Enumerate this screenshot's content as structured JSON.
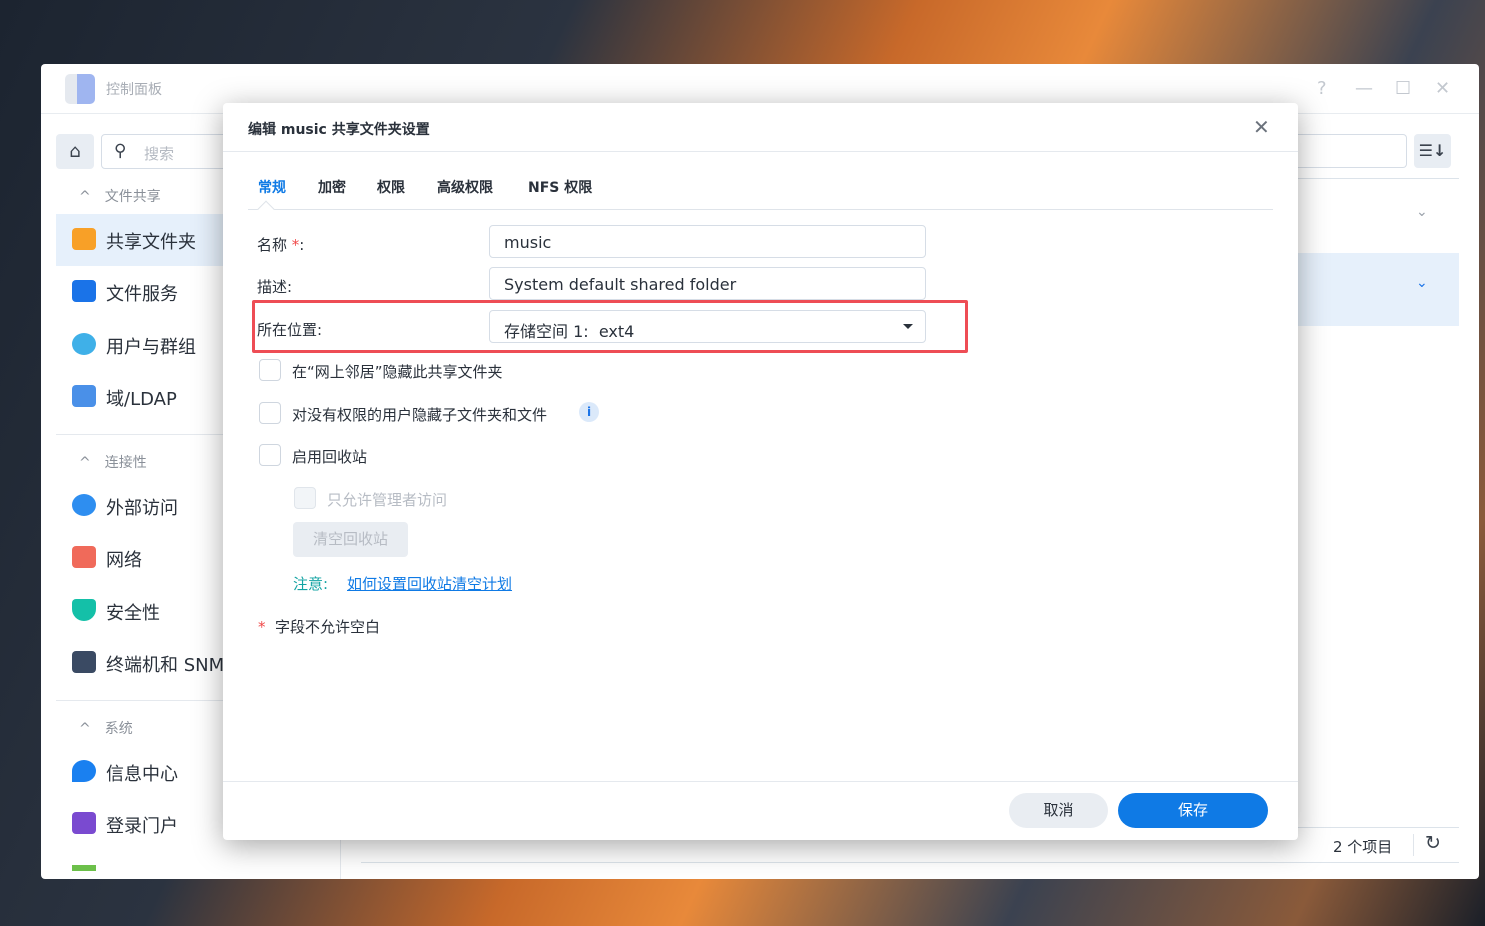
{
  "window": {
    "title": "控制面板",
    "controls": [
      "?",
      "—",
      "☐",
      "✕"
    ]
  },
  "sidebar": {
    "search_placeholder": "搜索",
    "sections": [
      {
        "title": "文件共享",
        "items": [
          {
            "label": "共享文件夹",
            "selected": true
          },
          {
            "label": "文件服务"
          },
          {
            "label": "用户与群组"
          },
          {
            "label": "域/LDAP"
          }
        ]
      },
      {
        "title": "连接性",
        "items": [
          {
            "label": "外部访问"
          },
          {
            "label": "网络"
          },
          {
            "label": "安全性"
          },
          {
            "label": "终端机和 SNMP"
          }
        ]
      },
      {
        "title": "系统",
        "items": [
          {
            "label": "信息中心"
          },
          {
            "label": "登录门户"
          }
        ]
      }
    ]
  },
  "main": {
    "status": "2 个项目"
  },
  "dialog": {
    "title": "编辑 music 共享文件夹设置",
    "tabs": [
      {
        "label": "常规",
        "active": true
      },
      {
        "label": "加密"
      },
      {
        "label": "权限"
      },
      {
        "label": "高级权限"
      },
      {
        "label": "NFS 权限"
      }
    ],
    "fields": {
      "name_label": "名称",
      "required_mark": "*",
      "name_value": "music",
      "desc_label": "描述:",
      "desc_value": "System default shared folder",
      "location_label": "所在位置:",
      "location_value": "存储空间 1:  ext4"
    },
    "checkboxes": [
      {
        "label": "在“网上邻居”隐藏此共享文件夹",
        "checked": false
      },
      {
        "label": "对没有权限的用户隐藏子文件夹和文件",
        "checked": false,
        "info": "i"
      },
      {
        "label": "启用回收站",
        "checked": false
      },
      {
        "label": "只允许管理者访问",
        "checked": false,
        "disabled": true
      }
    ],
    "clear_button": "清空回收站",
    "note_label": "注意:",
    "note_link": "如何设置回收站清空计划",
    "required_note": "字段不允许空白",
    "cancel": "取消",
    "save": "保存"
  },
  "colors": {
    "accent": "#0f7ae5",
    "highlight": "#ee4d55"
  }
}
